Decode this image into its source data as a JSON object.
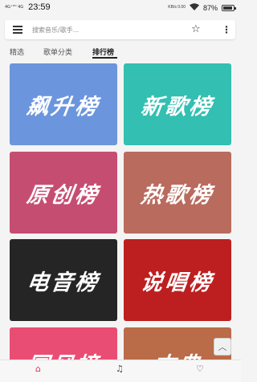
{
  "status_bar": {
    "network_left": "4G⁺ᴴᴰ\n4G",
    "time": "23:59",
    "network_right": "KB/s\n0.00",
    "battery_percent": "87%",
    "wifi_icon": "wifi-icon",
    "battery_icon": "battery-icon"
  },
  "header": {
    "search_placeholder": "搜索音乐/歌手...",
    "menu_icon": "menu-icon",
    "favorite_icon": "star-icon",
    "more_icon": "kebab-icon"
  },
  "tabs": [
    {
      "label": "精选",
      "active": false
    },
    {
      "label": "歌单分类",
      "active": false
    },
    {
      "label": "排行榜",
      "active": true
    }
  ],
  "charts": [
    {
      "label": "飙升榜",
      "color": "#6b95dc"
    },
    {
      "label": "新歌榜",
      "color": "#33bfb1"
    },
    {
      "label": "原创榜",
      "color": "#c64d72"
    },
    {
      "label": "热歌榜",
      "color": "#b96b5e"
    },
    {
      "label": "电音榜",
      "color": "#252525"
    },
    {
      "label": "说唱榜",
      "color": "#bd1f21"
    },
    {
      "label": "国风榜",
      "color": "#e94d73"
    },
    {
      "label": "古典",
      "color": "#ba6b47"
    }
  ],
  "scroll_top_icon": "chevron-up-icon",
  "bottom_nav": [
    {
      "icon": "home-icon",
      "glyph": "⌂",
      "active": true
    },
    {
      "icon": "music-note-icon",
      "glyph": "♫",
      "active": false
    },
    {
      "icon": "heart-icon",
      "glyph": "♡",
      "active": false
    }
  ]
}
